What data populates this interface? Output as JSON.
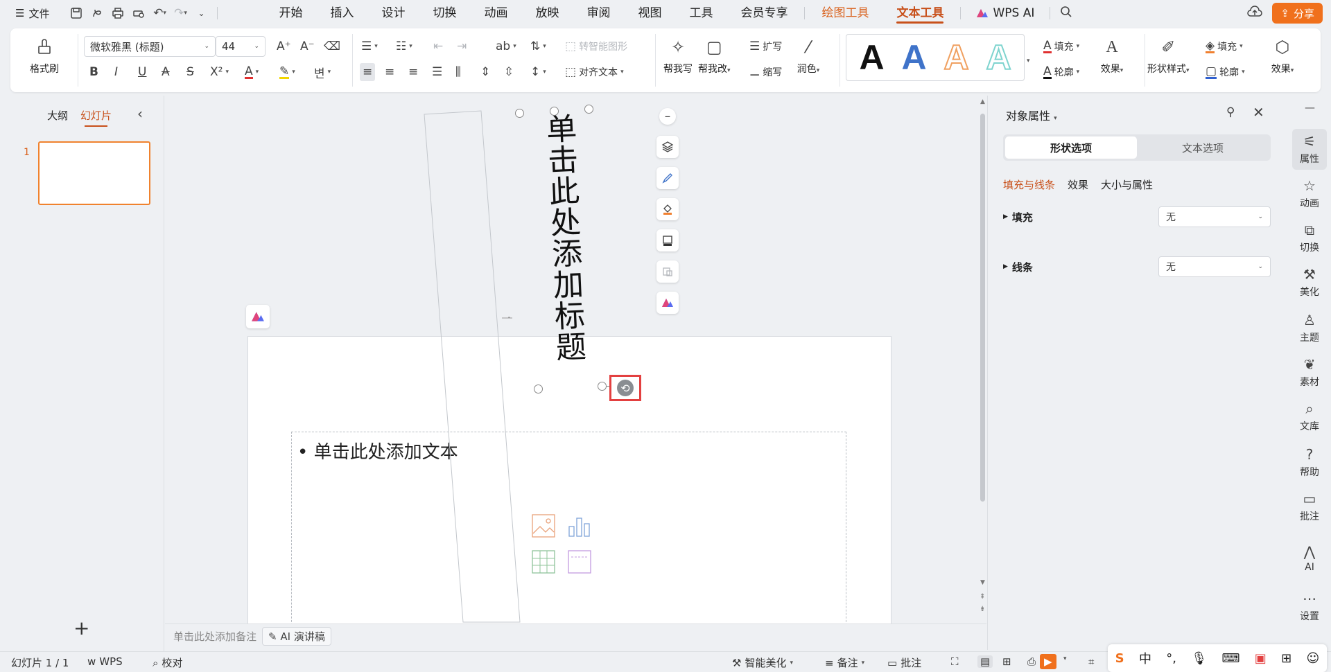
{
  "menubar": {
    "file_label": "文件",
    "tabs": [
      {
        "label": "开始"
      },
      {
        "label": "插入"
      },
      {
        "label": "设计"
      },
      {
        "label": "切换"
      },
      {
        "label": "动画"
      },
      {
        "label": "放映"
      },
      {
        "label": "审阅"
      },
      {
        "label": "视图"
      },
      {
        "label": "工具"
      },
      {
        "label": "会员专享"
      }
    ],
    "context_tabs": [
      {
        "label": "绘图工具"
      },
      {
        "label": "文本工具"
      }
    ],
    "wps_ai": "WPS AI",
    "share": "分享"
  },
  "ribbon": {
    "format_painter": "格式刷",
    "font_name": "微软雅黑 (标题)",
    "font_size": "44",
    "smart_shape": "转智能图形",
    "align_text": "对齐文本",
    "help_write": "帮我写",
    "help_edit": "帮我改",
    "expand": "扩写",
    "shrink": "缩写",
    "polish": "润色",
    "fill": "填充",
    "outline": "轮廓",
    "effect": "效果",
    "shape_style": "形状样式",
    "shape_fill": "填充",
    "shape_outline": "轮廓",
    "shape_effect": "效果",
    "wordart": [
      "A",
      "A",
      "A",
      "A"
    ],
    "colors": {
      "black": "#111111",
      "blue": "#3f73c9",
      "orange": "#f0a060",
      "teal": "#7fd4cf"
    }
  },
  "leftpanel": {
    "tab_outline": "大纲",
    "tab_slides": "幻灯片",
    "slide_number": "1"
  },
  "slide": {
    "title_placeholder": "单击此处添加标题",
    "body_placeholder": "• 单击此处添加文本"
  },
  "notes": {
    "placeholder": "单击此处添加备注",
    "ai_button": "AI 演讲稿"
  },
  "rpanel": {
    "title": "对象属性",
    "seg_shape": "形状选项",
    "seg_text": "文本选项",
    "sub_fill_line": "填充与线条",
    "sub_effect": "效果",
    "sub_size": "大小与属性",
    "fill_label": "填充",
    "fill_value": "无",
    "line_label": "线条",
    "line_value": "无"
  },
  "rsidebar": [
    {
      "label": "属性"
    },
    {
      "label": "动画"
    },
    {
      "label": "切换"
    },
    {
      "label": "美化"
    },
    {
      "label": "主题"
    },
    {
      "label": "素材"
    },
    {
      "label": "文库"
    },
    {
      "label": "帮助"
    },
    {
      "label": "批注"
    },
    {
      "label": "AI"
    },
    {
      "label": "设置"
    }
  ],
  "status": {
    "slide_count": "幻灯片 1 / 1",
    "wps": "WPS",
    "proof": "校对",
    "smart_beautify": "智能美化",
    "notes": "备注",
    "comments": "批注"
  },
  "ime": {
    "lang": "中",
    "punct": "°,"
  }
}
